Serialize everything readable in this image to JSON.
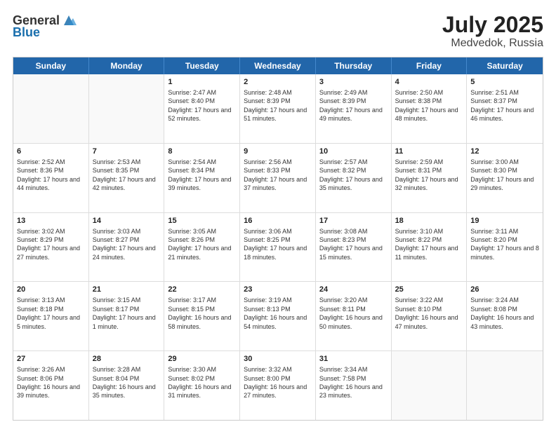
{
  "header": {
    "logo_general": "General",
    "logo_blue": "Blue",
    "month": "July 2025",
    "location": "Medvedok, Russia"
  },
  "weekdays": [
    "Sunday",
    "Monday",
    "Tuesday",
    "Wednesday",
    "Thursday",
    "Friday",
    "Saturday"
  ],
  "rows": [
    [
      {
        "day": "",
        "sunrise": "",
        "sunset": "",
        "daylight": ""
      },
      {
        "day": "",
        "sunrise": "",
        "sunset": "",
        "daylight": ""
      },
      {
        "day": "1",
        "sunrise": "Sunrise: 2:47 AM",
        "sunset": "Sunset: 8:40 PM",
        "daylight": "Daylight: 17 hours and 52 minutes."
      },
      {
        "day": "2",
        "sunrise": "Sunrise: 2:48 AM",
        "sunset": "Sunset: 8:39 PM",
        "daylight": "Daylight: 17 hours and 51 minutes."
      },
      {
        "day": "3",
        "sunrise": "Sunrise: 2:49 AM",
        "sunset": "Sunset: 8:39 PM",
        "daylight": "Daylight: 17 hours and 49 minutes."
      },
      {
        "day": "4",
        "sunrise": "Sunrise: 2:50 AM",
        "sunset": "Sunset: 8:38 PM",
        "daylight": "Daylight: 17 hours and 48 minutes."
      },
      {
        "day": "5",
        "sunrise": "Sunrise: 2:51 AM",
        "sunset": "Sunset: 8:37 PM",
        "daylight": "Daylight: 17 hours and 46 minutes."
      }
    ],
    [
      {
        "day": "6",
        "sunrise": "Sunrise: 2:52 AM",
        "sunset": "Sunset: 8:36 PM",
        "daylight": "Daylight: 17 hours and 44 minutes."
      },
      {
        "day": "7",
        "sunrise": "Sunrise: 2:53 AM",
        "sunset": "Sunset: 8:35 PM",
        "daylight": "Daylight: 17 hours and 42 minutes."
      },
      {
        "day": "8",
        "sunrise": "Sunrise: 2:54 AM",
        "sunset": "Sunset: 8:34 PM",
        "daylight": "Daylight: 17 hours and 39 minutes."
      },
      {
        "day": "9",
        "sunrise": "Sunrise: 2:56 AM",
        "sunset": "Sunset: 8:33 PM",
        "daylight": "Daylight: 17 hours and 37 minutes."
      },
      {
        "day": "10",
        "sunrise": "Sunrise: 2:57 AM",
        "sunset": "Sunset: 8:32 PM",
        "daylight": "Daylight: 17 hours and 35 minutes."
      },
      {
        "day": "11",
        "sunrise": "Sunrise: 2:59 AM",
        "sunset": "Sunset: 8:31 PM",
        "daylight": "Daylight: 17 hours and 32 minutes."
      },
      {
        "day": "12",
        "sunrise": "Sunrise: 3:00 AM",
        "sunset": "Sunset: 8:30 PM",
        "daylight": "Daylight: 17 hours and 29 minutes."
      }
    ],
    [
      {
        "day": "13",
        "sunrise": "Sunrise: 3:02 AM",
        "sunset": "Sunset: 8:29 PM",
        "daylight": "Daylight: 17 hours and 27 minutes."
      },
      {
        "day": "14",
        "sunrise": "Sunrise: 3:03 AM",
        "sunset": "Sunset: 8:27 PM",
        "daylight": "Daylight: 17 hours and 24 minutes."
      },
      {
        "day": "15",
        "sunrise": "Sunrise: 3:05 AM",
        "sunset": "Sunset: 8:26 PM",
        "daylight": "Daylight: 17 hours and 21 minutes."
      },
      {
        "day": "16",
        "sunrise": "Sunrise: 3:06 AM",
        "sunset": "Sunset: 8:25 PM",
        "daylight": "Daylight: 17 hours and 18 minutes."
      },
      {
        "day": "17",
        "sunrise": "Sunrise: 3:08 AM",
        "sunset": "Sunset: 8:23 PM",
        "daylight": "Daylight: 17 hours and 15 minutes."
      },
      {
        "day": "18",
        "sunrise": "Sunrise: 3:10 AM",
        "sunset": "Sunset: 8:22 PM",
        "daylight": "Daylight: 17 hours and 11 minutes."
      },
      {
        "day": "19",
        "sunrise": "Sunrise: 3:11 AM",
        "sunset": "Sunset: 8:20 PM",
        "daylight": "Daylight: 17 hours and 8 minutes."
      }
    ],
    [
      {
        "day": "20",
        "sunrise": "Sunrise: 3:13 AM",
        "sunset": "Sunset: 8:18 PM",
        "daylight": "Daylight: 17 hours and 5 minutes."
      },
      {
        "day": "21",
        "sunrise": "Sunrise: 3:15 AM",
        "sunset": "Sunset: 8:17 PM",
        "daylight": "Daylight: 17 hours and 1 minute."
      },
      {
        "day": "22",
        "sunrise": "Sunrise: 3:17 AM",
        "sunset": "Sunset: 8:15 PM",
        "daylight": "Daylight: 16 hours and 58 minutes."
      },
      {
        "day": "23",
        "sunrise": "Sunrise: 3:19 AM",
        "sunset": "Sunset: 8:13 PM",
        "daylight": "Daylight: 16 hours and 54 minutes."
      },
      {
        "day": "24",
        "sunrise": "Sunrise: 3:20 AM",
        "sunset": "Sunset: 8:11 PM",
        "daylight": "Daylight: 16 hours and 50 minutes."
      },
      {
        "day": "25",
        "sunrise": "Sunrise: 3:22 AM",
        "sunset": "Sunset: 8:10 PM",
        "daylight": "Daylight: 16 hours and 47 minutes."
      },
      {
        "day": "26",
        "sunrise": "Sunrise: 3:24 AM",
        "sunset": "Sunset: 8:08 PM",
        "daylight": "Daylight: 16 hours and 43 minutes."
      }
    ],
    [
      {
        "day": "27",
        "sunrise": "Sunrise: 3:26 AM",
        "sunset": "Sunset: 8:06 PM",
        "daylight": "Daylight: 16 hours and 39 minutes."
      },
      {
        "day": "28",
        "sunrise": "Sunrise: 3:28 AM",
        "sunset": "Sunset: 8:04 PM",
        "daylight": "Daylight: 16 hours and 35 minutes."
      },
      {
        "day": "29",
        "sunrise": "Sunrise: 3:30 AM",
        "sunset": "Sunset: 8:02 PM",
        "daylight": "Daylight: 16 hours and 31 minutes."
      },
      {
        "day": "30",
        "sunrise": "Sunrise: 3:32 AM",
        "sunset": "Sunset: 8:00 PM",
        "daylight": "Daylight: 16 hours and 27 minutes."
      },
      {
        "day": "31",
        "sunrise": "Sunrise: 3:34 AM",
        "sunset": "Sunset: 7:58 PM",
        "daylight": "Daylight: 16 hours and 23 minutes."
      },
      {
        "day": "",
        "sunrise": "",
        "sunset": "",
        "daylight": ""
      },
      {
        "day": "",
        "sunrise": "",
        "sunset": "",
        "daylight": ""
      }
    ]
  ]
}
